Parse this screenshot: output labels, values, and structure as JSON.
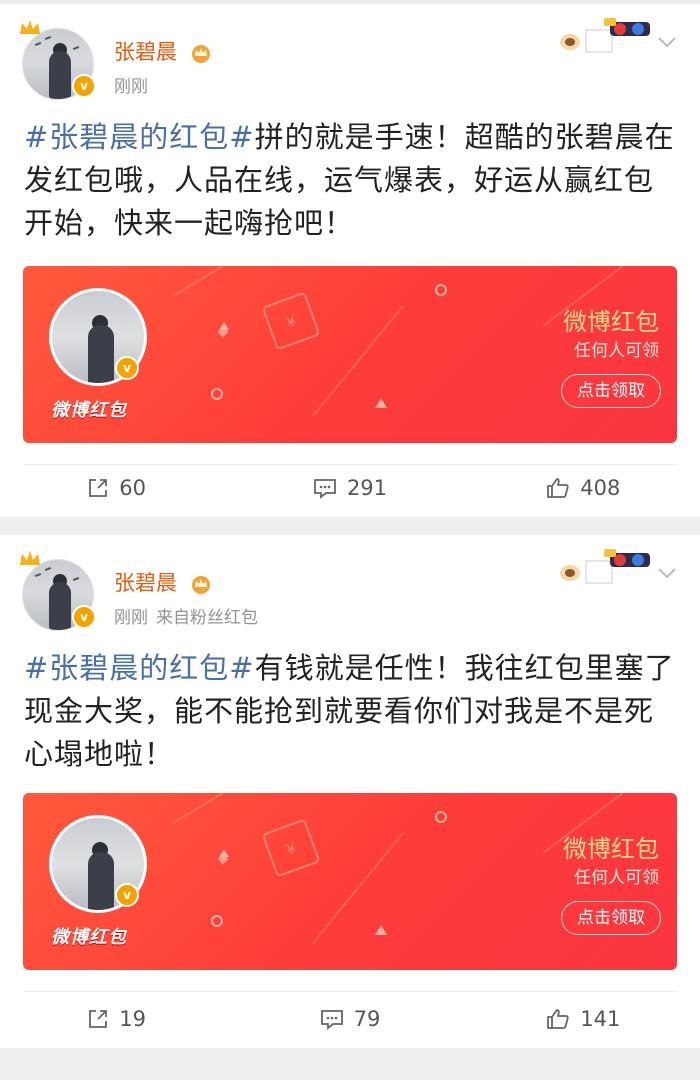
{
  "posts": [
    {
      "author": "张碧晨",
      "time": "刚刚",
      "source": "",
      "hashtag": "#张碧晨的红包#",
      "body": "拼的就是手速！超酷的张碧晨在发红包哦，人品在线，运气爆表，好运从赢红包开始，快来一起嗨抢吧！",
      "card": {
        "title": "微博红包",
        "subtitle": "任何人可领",
        "button": "点击领取",
        "badge_text": "微博红包"
      },
      "stats": {
        "repost": "60",
        "comment": "291",
        "like": "408"
      }
    },
    {
      "author": "张碧晨",
      "time": "刚刚",
      "source": "来自粉丝红包",
      "hashtag": "#张碧晨的红包#",
      "body": "有钱就是任性！我往红包里塞了现金大奖，能不能抢到就要看你们对我是不是死心塌地啦！",
      "card": {
        "title": "微博红包",
        "subtitle": "任何人可领",
        "button": "点击领取",
        "badge_text": "微博红包"
      },
      "stats": {
        "repost": "19",
        "comment": "79",
        "like": "141"
      }
    }
  ],
  "icons": {
    "repost": "share-icon",
    "comment": "comment-icon",
    "like": "thumbs-up-icon",
    "more": "chevron-down-icon"
  },
  "colors": {
    "accent_name": "#e8590c",
    "hashtag": "#4a6fa8",
    "card_red": "#fd3d3a",
    "card_title": "#ffd98a"
  }
}
